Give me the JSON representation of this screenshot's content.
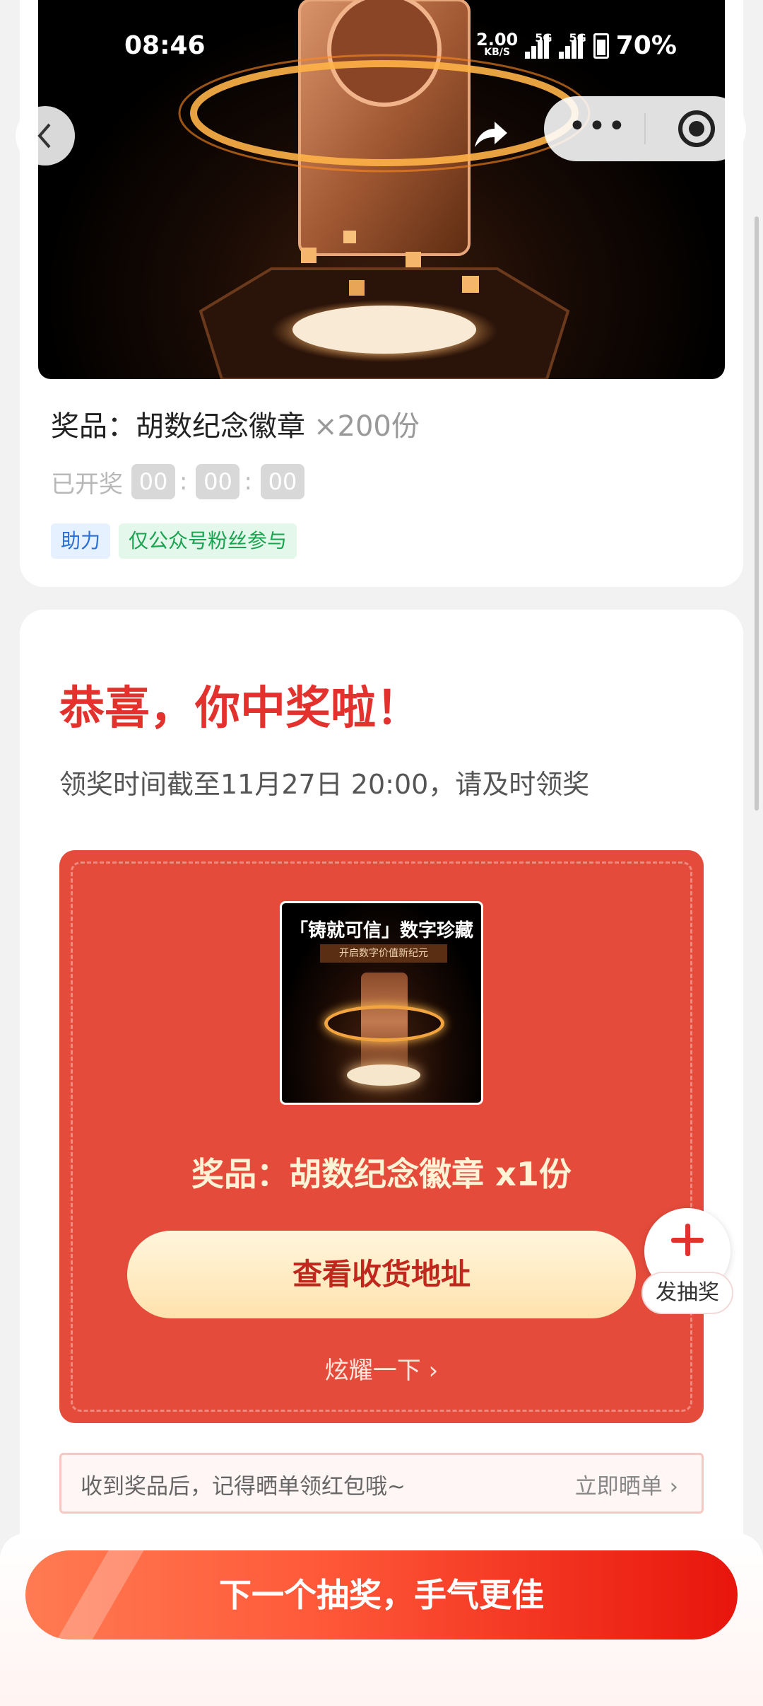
{
  "status_bar": {
    "time": "08:46",
    "net_speed_value": "2.00",
    "net_speed_unit": "KB/S",
    "net1": "5G",
    "net2": "5G",
    "battery": "70%"
  },
  "lottery": {
    "prize_label": "奖品：胡数纪念徽章",
    "prize_qty": "×200份",
    "status_text": "已开奖",
    "countdown": [
      "00",
      "00",
      "00"
    ],
    "tags": [
      "助力",
      "仅公众号粉丝参与"
    ]
  },
  "result": {
    "title": "恭喜，你中奖啦！",
    "deadline": "领奖时间截至11月27日 20:00，请及时领奖",
    "prize_image_title": "「铸就可信」数字珍藏",
    "prize_image_subtitle": "开启数字价值新纪元",
    "prize_name": "奖品：胡数纪念徽章 x1份",
    "address_button": "查看收货地址",
    "show_off": "炫耀一下 ›"
  },
  "fab": {
    "label": "发抽奖",
    "icon": "plus-icon"
  },
  "tip": {
    "text": "收到奖品后，记得晒单领红包哦~",
    "link": "立即晒单 ›"
  },
  "bottom": {
    "next_button": "下一个抽奖，手气更佳"
  },
  "colors": {
    "accent_red": "#e3322d",
    "prize_box_red": "#e54b3b",
    "button_gold": "#ffe2ad"
  }
}
